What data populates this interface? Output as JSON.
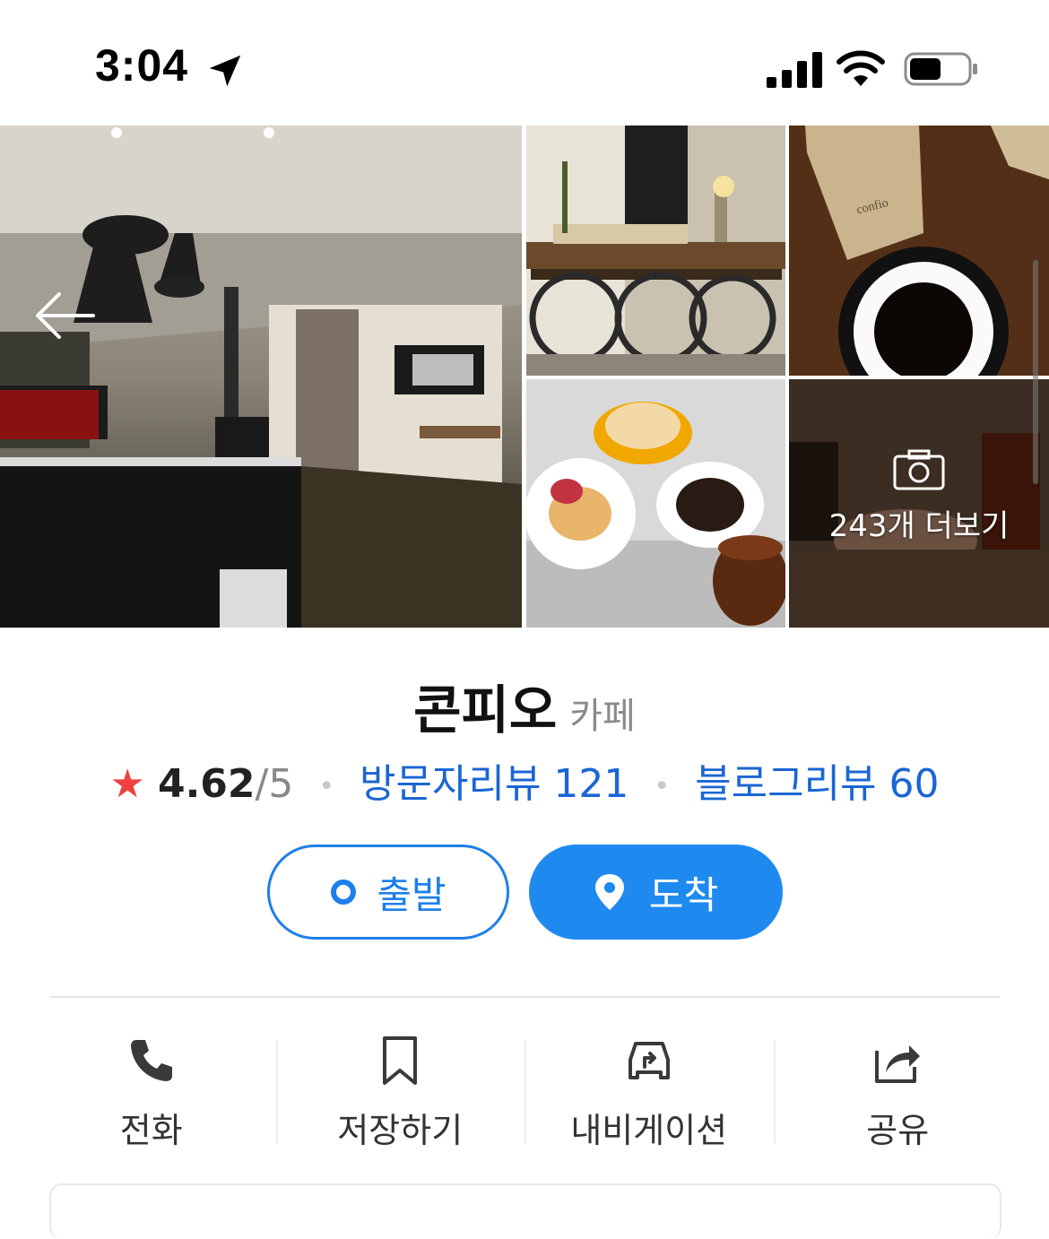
{
  "status_bar": {
    "time": "3:04"
  },
  "gallery": {
    "more_label": "243개 더보기"
  },
  "place": {
    "name": "콘피오",
    "category": "카페"
  },
  "rating": {
    "star": "★",
    "value": "4.62",
    "max": "/5",
    "visitor_reviews": "방문자리뷰 121",
    "blog_reviews": "블로그리뷰 60"
  },
  "route": {
    "depart_label": "출발",
    "arrive_label": "도착"
  },
  "actions": [
    {
      "label": "전화",
      "icon": "phone-icon"
    },
    {
      "label": "저장하기",
      "icon": "bookmark-icon"
    },
    {
      "label": "내비게이션",
      "icon": "car-navigation-icon"
    },
    {
      "label": "공유",
      "icon": "share-icon"
    }
  ],
  "colors": {
    "accent": "#1e8af0",
    "link": "#1a66d4",
    "star": "#f04040"
  }
}
